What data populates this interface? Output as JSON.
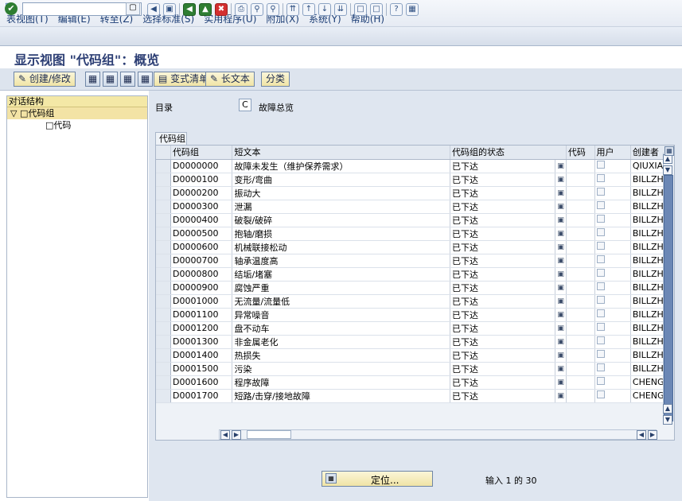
{
  "menubar": {
    "items": [
      "表视图(T)",
      "编辑(E)",
      "转至(Z)",
      "选择标准(S)",
      "实用程序(U)",
      "附加(X)",
      "系统(Y)",
      "帮助(H)"
    ]
  },
  "toolbar": {
    "ok_icon": "checkmark-icon"
  },
  "title": "显示视图 \"代码组\"：概览",
  "app_toolbar": {
    "create_change": "创建/修改",
    "variant_list": "变式清单",
    "long_text": "长文本",
    "classification": "分类"
  },
  "tree": {
    "header": "对话结构",
    "node_group": "代码组",
    "node_code": "代码"
  },
  "catalog": {
    "label": "目录",
    "value": "C",
    "description": "故障总览"
  },
  "table": {
    "tab_label": "代码组",
    "columns": [
      "代码组",
      "短文本",
      "代码组的状态",
      "代码",
      "用户",
      "创建者"
    ],
    "rows": [
      [
        "D0000000",
        "故障未发生（维护保养需求）",
        "已下达",
        "QIUXIAC"
      ],
      [
        "D0000100",
        "变形/弯曲",
        "已下达",
        "BILLZHC"
      ],
      [
        "D0000200",
        "振动大",
        "已下达",
        "BILLZHC"
      ],
      [
        "D0000300",
        "泄漏",
        "已下达",
        "BILLZHC"
      ],
      [
        "D0000400",
        "破裂/破碎",
        "已下达",
        "BILLZHC"
      ],
      [
        "D0000500",
        "抱轴/磨损",
        "已下达",
        "BILLZHC"
      ],
      [
        "D0000600",
        "机械联接松动",
        "已下达",
        "BILLZHC"
      ],
      [
        "D0000700",
        "轴承温度高",
        "已下达",
        "BILLZHC"
      ],
      [
        "D0000800",
        "结垢/堵塞",
        "已下达",
        "BILLZHC"
      ],
      [
        "D0000900",
        "腐蚀严重",
        "已下达",
        "BILLZHC"
      ],
      [
        "D0001000",
        "无流量/流量低",
        "已下达",
        "BILLZHC"
      ],
      [
        "D0001100",
        "异常噪音",
        "已下达",
        "BILLZHC"
      ],
      [
        "D0001200",
        "盘不动车",
        "已下达",
        "BILLZHC"
      ],
      [
        "D0001300",
        "非金属老化",
        "已下达",
        "BILLZHC"
      ],
      [
        "D0001400",
        "热损失",
        "已下达",
        "BILLZHC"
      ],
      [
        "D0001500",
        "污染",
        "已下达",
        "BILLZHC"
      ],
      [
        "D0001600",
        "程序故障",
        "已下达",
        "CHENGYI"
      ],
      [
        "D0001700",
        "短路/击穿/接地故障",
        "已下达",
        "CHENGYI"
      ]
    ]
  },
  "footer": {
    "position_button": "定位...",
    "entry_info": "输入 1 的 30"
  }
}
